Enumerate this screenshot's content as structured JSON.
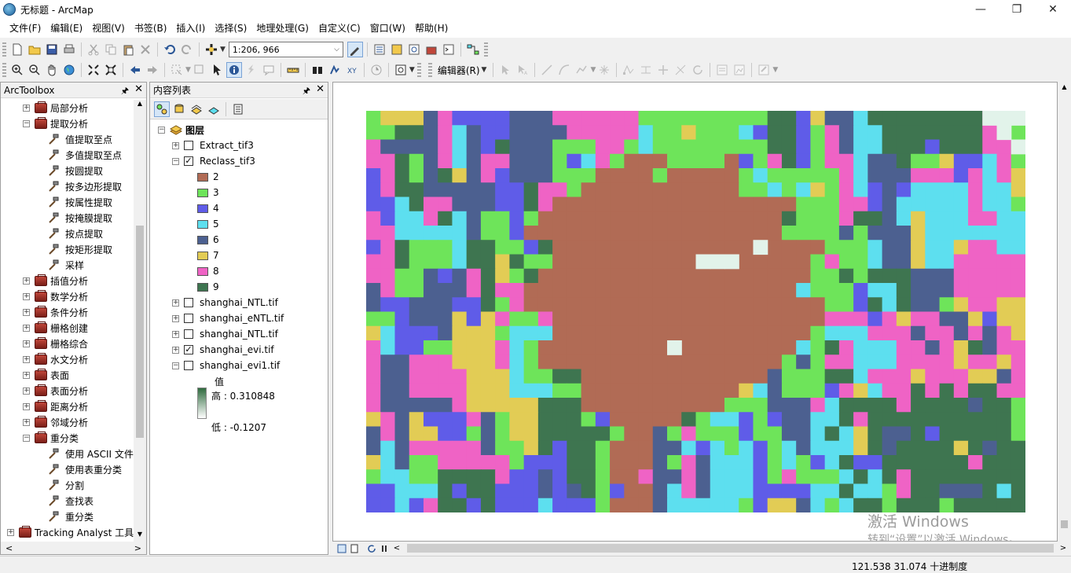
{
  "window": {
    "title": "无标题 - ArcMap"
  },
  "menu": [
    "文件(F)",
    "编辑(E)",
    "视图(V)",
    "书签(B)",
    "插入(I)",
    "选择(S)",
    "地理处理(G)",
    "自定义(C)",
    "窗口(W)",
    "帮助(H)"
  ],
  "toolbar": {
    "scale_value": "1:206, 966",
    "editor_label": "编辑器(R)"
  },
  "toolbox": {
    "title": "ArcToolbox",
    "items": [
      {
        "label": "局部分析",
        "type": "group",
        "expanded": false
      },
      {
        "label": "提取分析",
        "type": "group",
        "expanded": true
      },
      {
        "label": "值提取至点",
        "type": "tool"
      },
      {
        "label": "多值提取至点",
        "type": "tool"
      },
      {
        "label": "按圆提取",
        "type": "tool"
      },
      {
        "label": "按多边形提取",
        "type": "tool"
      },
      {
        "label": "按属性提取",
        "type": "tool"
      },
      {
        "label": "按掩膜提取",
        "type": "tool"
      },
      {
        "label": "按点提取",
        "type": "tool"
      },
      {
        "label": "按矩形提取",
        "type": "tool"
      },
      {
        "label": "采样",
        "type": "tool"
      },
      {
        "label": "插值分析",
        "type": "group",
        "expanded": false
      },
      {
        "label": "数学分析",
        "type": "group",
        "expanded": false
      },
      {
        "label": "条件分析",
        "type": "group",
        "expanded": false
      },
      {
        "label": "栅格创建",
        "type": "group",
        "expanded": false
      },
      {
        "label": "栅格综合",
        "type": "group",
        "expanded": false
      },
      {
        "label": "水文分析",
        "type": "group",
        "expanded": false
      },
      {
        "label": "表面",
        "type": "group",
        "expanded": false
      },
      {
        "label": "表面分析",
        "type": "group",
        "expanded": false
      },
      {
        "label": "距离分析",
        "type": "group",
        "expanded": false
      },
      {
        "label": "邻域分析",
        "type": "group",
        "expanded": false
      },
      {
        "label": "重分类",
        "type": "group",
        "expanded": true
      },
      {
        "label": "使用 ASCII 文件",
        "type": "tool"
      },
      {
        "label": "使用表重分类",
        "type": "tool"
      },
      {
        "label": "分割",
        "type": "tool"
      },
      {
        "label": "查找表",
        "type": "tool"
      },
      {
        "label": "重分类",
        "type": "tool"
      },
      {
        "label": "Tracking Analyst 工具",
        "type": "root",
        "expanded": false
      }
    ]
  },
  "toc": {
    "title": "内容列表",
    "root_label": "图层",
    "layers": [
      {
        "name": "Extract_tif3",
        "checked": false,
        "expanded": false
      },
      {
        "name": "Reclass_tif3",
        "checked": true,
        "expanded": true
      },
      {
        "name": "shanghai_NTL.tif",
        "checked": false,
        "expanded": false
      },
      {
        "name": "shanghai_eNTL.tif",
        "checked": false,
        "expanded": false
      },
      {
        "name": "shanghai_NTL.tif",
        "checked": false,
        "expanded": false
      },
      {
        "name": "shanghai_evi.tif",
        "checked": true,
        "expanded": false
      },
      {
        "name": "shanghai_evi1.tif",
        "checked": false,
        "expanded": true
      }
    ],
    "reclass_legend": [
      {
        "label": "2",
        "color": "#b16b55"
      },
      {
        "label": "3",
        "color": "#6ee45a"
      },
      {
        "label": "4",
        "color": "#5f5ce8"
      },
      {
        "label": "5",
        "color": "#5ddfef"
      },
      {
        "label": "6",
        "color": "#4c6090"
      },
      {
        "label": "7",
        "color": "#e2cc55"
      },
      {
        "label": "8",
        "color": "#ef63c5"
      },
      {
        "label": "9",
        "color": "#3e7550"
      }
    ],
    "evi_legend": {
      "title": "值",
      "high_label": "高 : 0.310848",
      "low_label": "低 : -0.1207"
    }
  },
  "map": {
    "raster_cols": 46,
    "raster_rows": 28,
    "background_cell_color": "#e2f3ea"
  },
  "watermark": {
    "line1": "激活 Windows",
    "line2": "转到“设置”以激活 Windows。"
  },
  "status": {
    "coords": "121.538  31.074 十进制度"
  }
}
